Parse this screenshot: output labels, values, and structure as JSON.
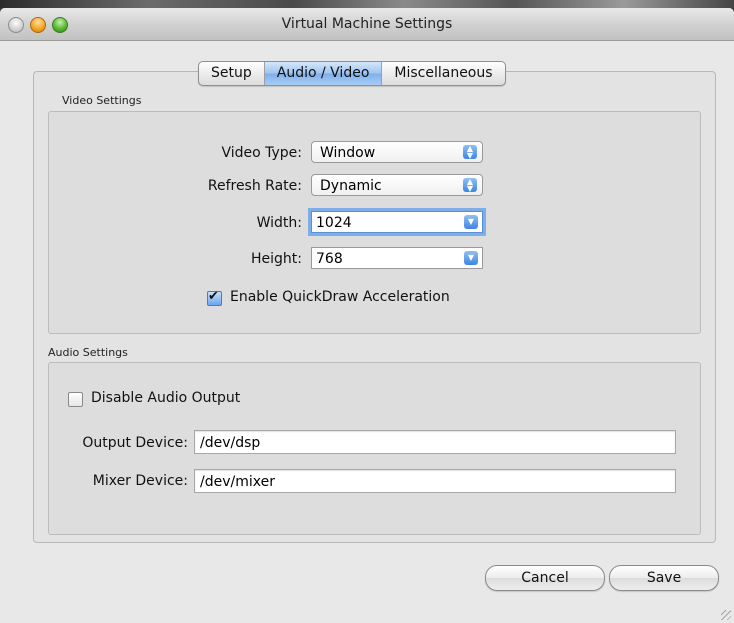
{
  "window": {
    "title": "Virtual Machine Settings"
  },
  "tabs": [
    "Setup",
    "Audio / Video",
    "Miscellaneous"
  ],
  "active_tab": "Audio / Video",
  "video": {
    "group_label": "Video Settings",
    "video_type": {
      "label": "Video Type:",
      "value": "Window"
    },
    "refresh_rate": {
      "label": "Refresh Rate:",
      "value": "Dynamic"
    },
    "width": {
      "label": "Width:",
      "value": "1024"
    },
    "height": {
      "label": "Height:",
      "value": "768"
    },
    "quickdraw": {
      "label": "Enable QuickDraw Acceleration",
      "checked": true
    }
  },
  "audio": {
    "group_label": "Audio Settings",
    "disable_output": {
      "label": "Disable Audio Output",
      "checked": false
    },
    "output_device": {
      "label": "Output Device:",
      "value": "/dev/dsp"
    },
    "mixer_device": {
      "label": "Mixer Device:",
      "value": "/dev/mixer"
    }
  },
  "buttons": {
    "cancel": "Cancel",
    "save": "Save"
  },
  "colors": {
    "accent": "#7fb0ea",
    "window_bg": "#e8e8e8"
  },
  "icons": [
    "close-button",
    "minimize-button",
    "zoom-button",
    "popup-arrows-icon",
    "combo-arrow-icon",
    "check-icon"
  ]
}
